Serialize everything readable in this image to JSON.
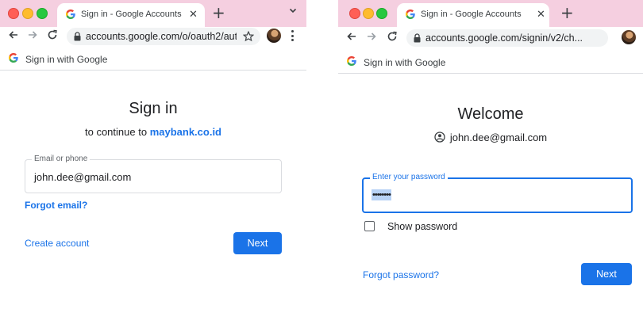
{
  "left": {
    "tab_title": "Sign in - Google Accounts",
    "url": "accounts.google.com/o/oauth2/aut...",
    "siwg_label": "Sign in with Google",
    "heading": "Sign in",
    "subtitle_prefix": "to continue to",
    "subtitle_link": "maybank.co.id",
    "email_label": "Email or phone",
    "email_value": "john.dee@gmail.com",
    "forgot_email": "Forgot email?",
    "create_account": "Create account",
    "next": "Next"
  },
  "right": {
    "tab_title": "Sign in - Google Accounts",
    "url": "accounts.google.com/signin/v2/ch...",
    "siwg_label": "Sign in with Google",
    "heading": "Welcome",
    "account_email": "john.dee@gmail.com",
    "password_label": "Enter your password",
    "password_mask": "••••••••",
    "show_password": "Show password",
    "forgot_password": "Forgot password?",
    "next": "Next"
  },
  "colors": {
    "tab_strip": "#f5cfe0",
    "accent_blue": "#1a73e8"
  },
  "icons": [
    "google-g-icon",
    "close-icon",
    "plus-icon",
    "chevron-down-icon",
    "back-arrow-icon",
    "forward-arrow-icon",
    "reload-icon",
    "lock-icon",
    "star-icon",
    "profile-avatar",
    "more-vert-icon",
    "account-circle-icon"
  ]
}
